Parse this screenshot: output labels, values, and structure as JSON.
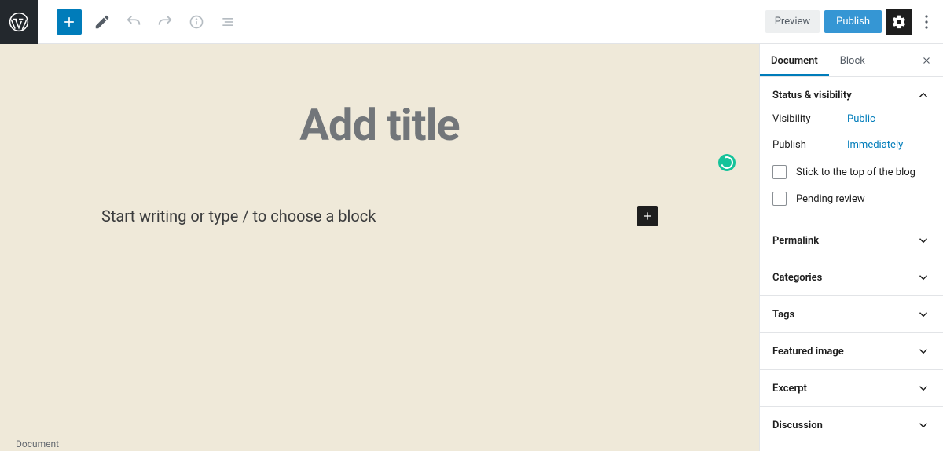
{
  "topbar": {
    "preview_label": "Preview",
    "publish_label": "Publish"
  },
  "editor": {
    "title_placeholder": "Add title",
    "block_placeholder": "Start writing or type / to choose a block"
  },
  "sidebar": {
    "tabs": {
      "document": "Document",
      "block": "Block"
    },
    "status": {
      "heading": "Status & visibility",
      "visibility_label": "Visibility",
      "visibility_value": "Public",
      "publish_label": "Publish",
      "publish_value": "Immediately",
      "stick_label": "Stick to the top of the blog",
      "pending_label": "Pending review"
    },
    "panels": {
      "permalink": "Permalink",
      "categories": "Categories",
      "tags": "Tags",
      "featured_image": "Featured image",
      "excerpt": "Excerpt",
      "discussion": "Discussion"
    }
  },
  "footer": {
    "note": "Document"
  },
  "colors": {
    "accent": "#007cba",
    "publish": "#3596d4",
    "canvas": "#efe9d9"
  }
}
